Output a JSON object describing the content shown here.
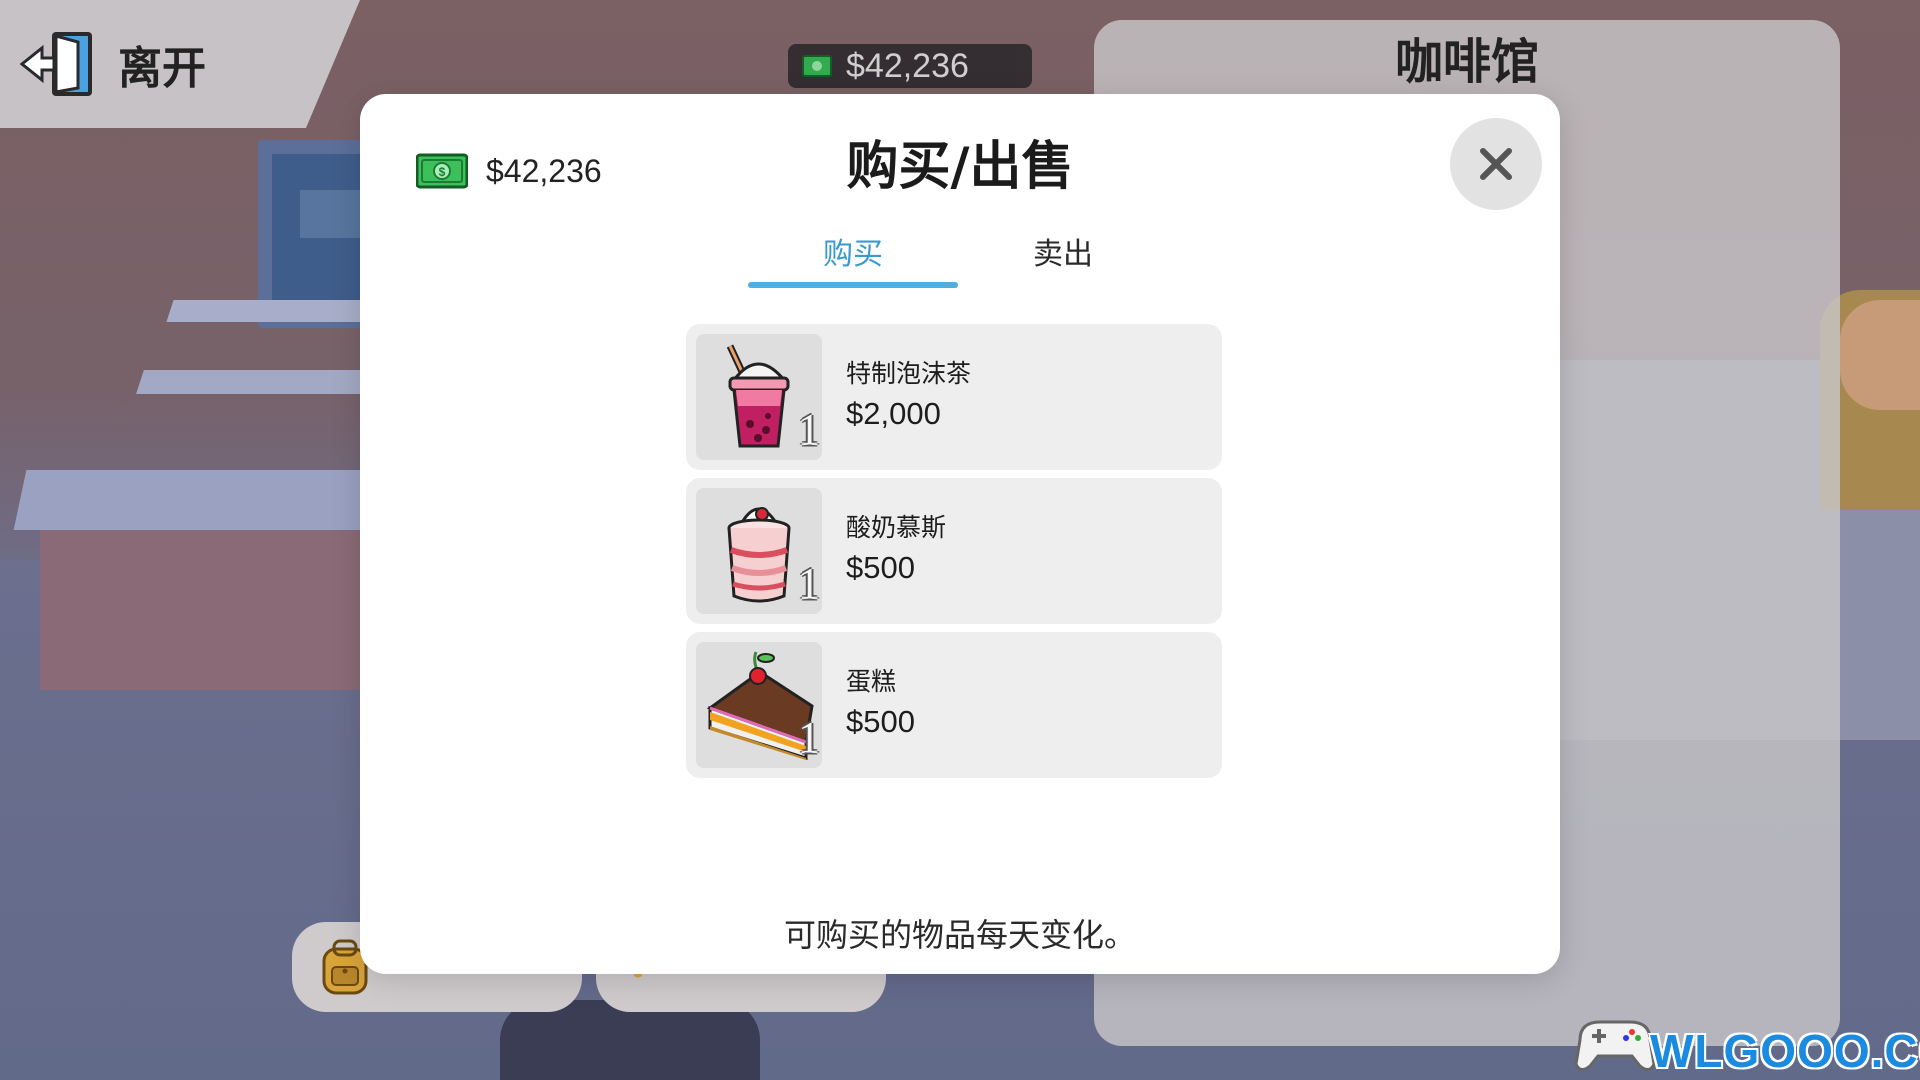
{
  "exit_label": "离开",
  "balance": "$42,236",
  "shop_title": "咖啡馆",
  "modal": {
    "title": "购买/出售",
    "tabs": [
      {
        "label": "购买",
        "active": true
      },
      {
        "label": "卖出",
        "active": false
      }
    ],
    "items": [
      {
        "name": "特制泡沫茶",
        "price": "$2,000",
        "qty": "1",
        "icon": "bubble-tea-icon"
      },
      {
        "name": "酸奶慕斯",
        "price": "$500",
        "qty": "1",
        "icon": "yogurt-mousse-icon"
      },
      {
        "name": "蛋糕",
        "price": "$500",
        "qty": "1",
        "icon": "cake-slice-icon"
      }
    ],
    "footer_note": "可购买的物品每天变化。"
  },
  "watermark": "WLGOOO.COM",
  "colors": {
    "active_tab": "#3a9ad0",
    "modal_background": "#ffffff",
    "item_card_background": "#eeeeee"
  }
}
